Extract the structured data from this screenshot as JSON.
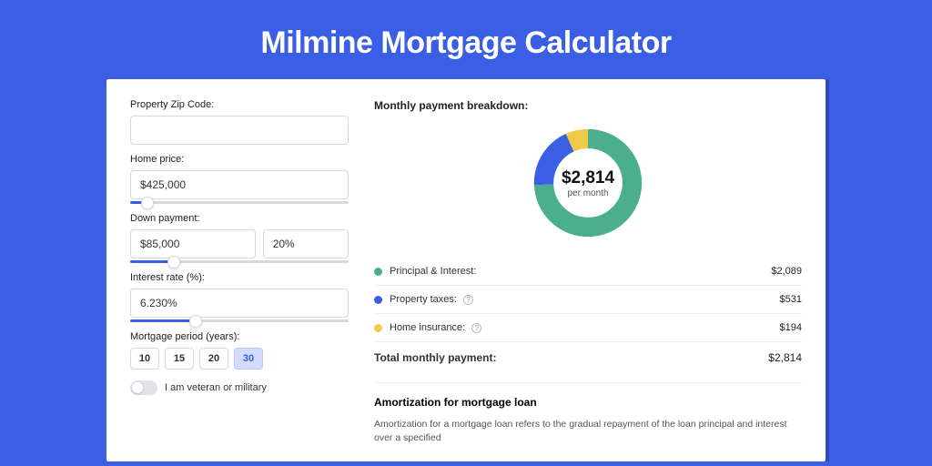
{
  "title": "Milmine Mortgage Calculator",
  "form": {
    "zip": {
      "label": "Property Zip Code:",
      "value": ""
    },
    "price": {
      "label": "Home price:",
      "value": "$425,000",
      "slider_pct": 8
    },
    "down": {
      "label": "Down payment:",
      "amount": "$85,000",
      "pct": "20%",
      "slider_pct": 20
    },
    "rate": {
      "label": "Interest rate (%):",
      "value": "6.230%",
      "slider_pct": 30
    },
    "period": {
      "label": "Mortgage period (years):",
      "options": [
        "10",
        "15",
        "20",
        "30"
      ],
      "active": "30"
    },
    "veteran": {
      "label": "I am veteran or military",
      "on": false
    }
  },
  "breakdown": {
    "title": "Monthly payment breakdown:",
    "center_amount": "$2,814",
    "center_sub": "per month",
    "items": [
      {
        "color": "green",
        "label": "Principal & Interest:",
        "value": "$2,089",
        "info": false
      },
      {
        "color": "blue",
        "label": "Property taxes:",
        "value": "$531",
        "info": true
      },
      {
        "color": "yellow",
        "label": "Home insurance:",
        "value": "$194",
        "info": true
      }
    ],
    "total_label": "Total monthly payment:",
    "total_value": "$2,814"
  },
  "chart_data": {
    "type": "pie",
    "title": "Monthly payment breakdown",
    "series": [
      {
        "name": "Principal & Interest",
        "value": 2089,
        "color": "#4BAE8C"
      },
      {
        "name": "Property taxes",
        "value": 531,
        "color": "#3A5FE5"
      },
      {
        "name": "Home insurance",
        "value": 194,
        "color": "#F0C949"
      }
    ],
    "total": 2814,
    "unit": "USD per month"
  },
  "amort": {
    "title": "Amortization for mortgage loan",
    "text": "Amortization for a mortgage loan refers to the gradual repayment of the loan principal and interest over a specified"
  }
}
